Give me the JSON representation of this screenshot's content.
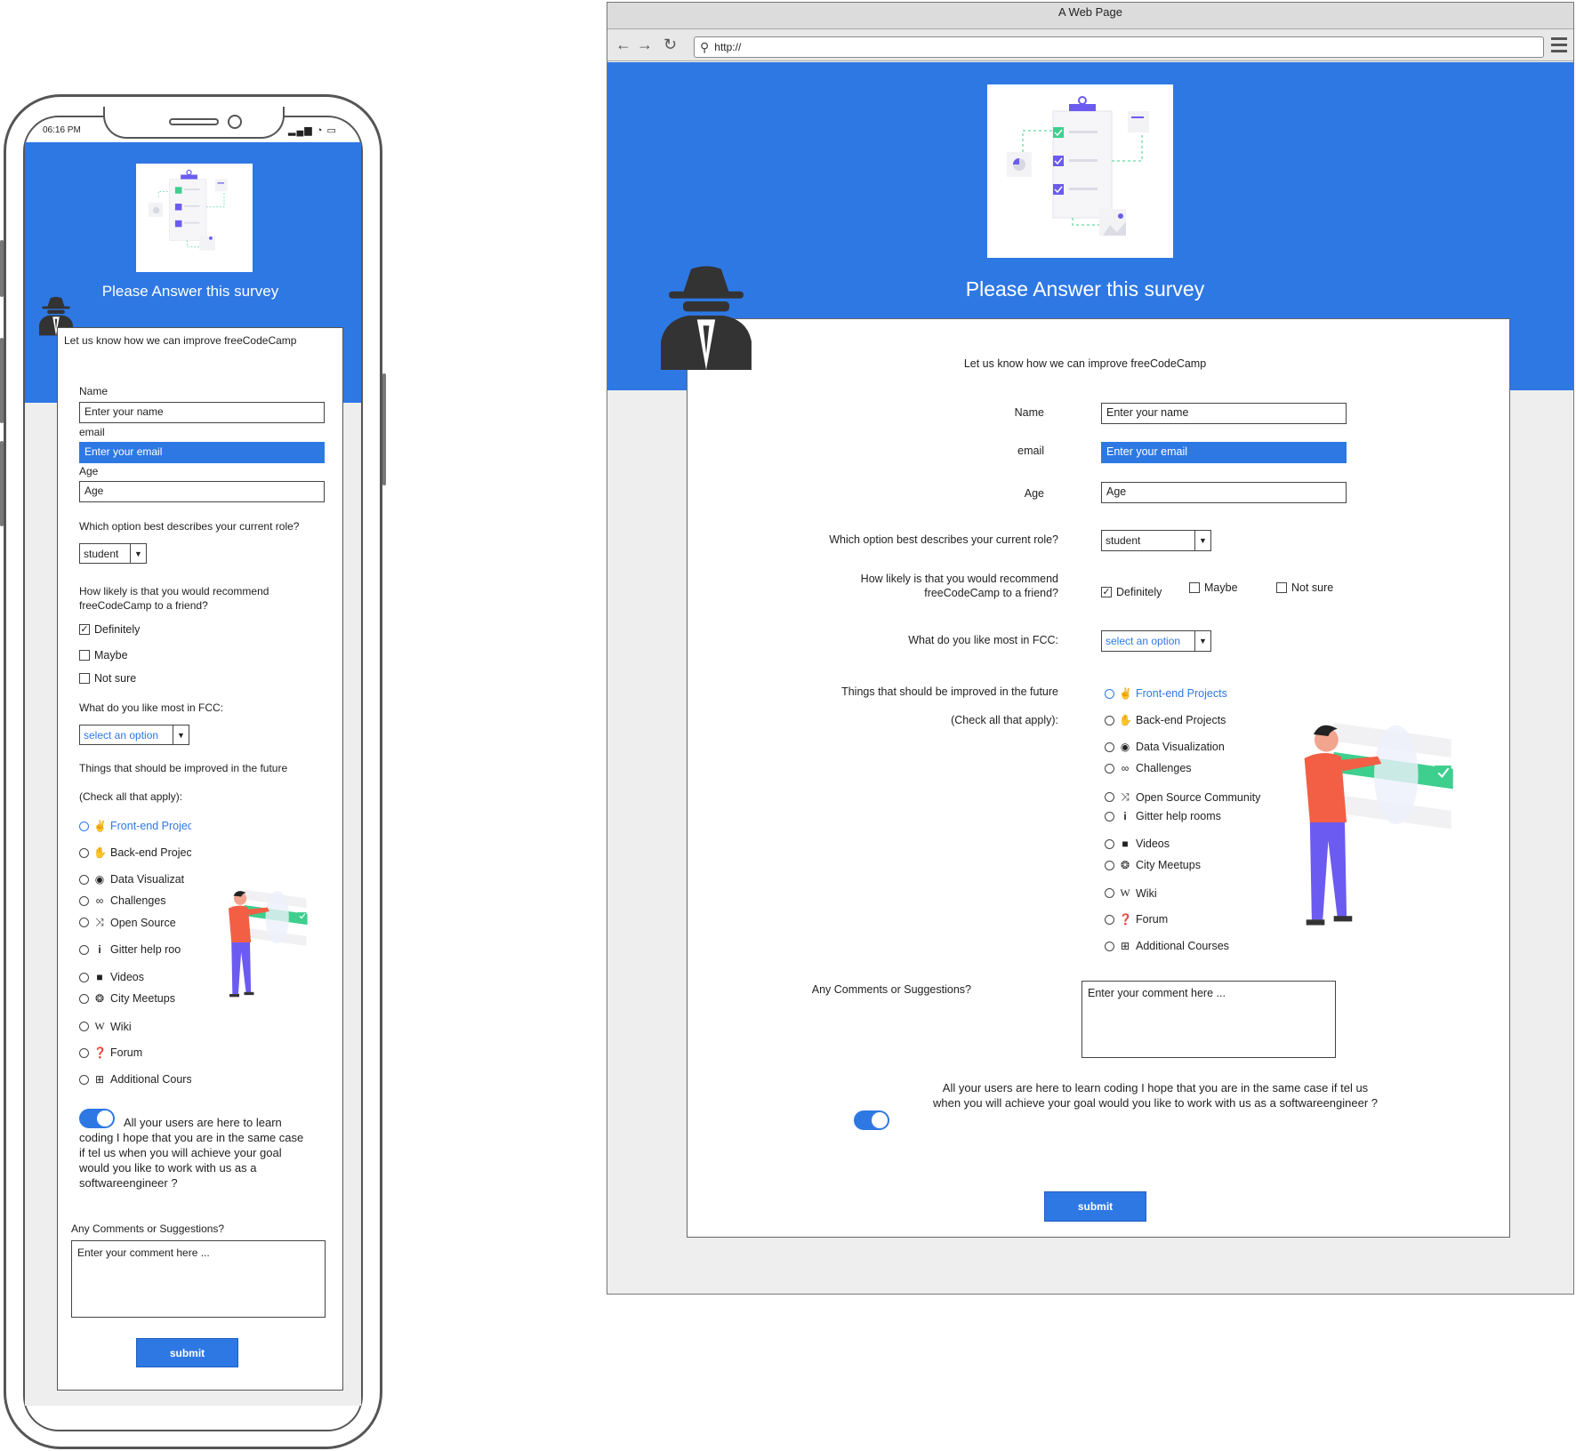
{
  "mobile": {
    "status_time": "06:16 PM",
    "status_icons": "▂▄▆ ◔ ▭",
    "title": "Please Answer this survey",
    "subtitle": "Let us know how we can improve freeCodeCamp",
    "name_label": "Name",
    "name_placeholder": "Enter your name",
    "email_label": "email",
    "email_placeholder": "Enter your email",
    "age_label": "Age",
    "age_placeholder": "Age",
    "role_question": "Which option best describes your current role?",
    "role_value": "student",
    "recommend_question_1": "How likely is that you would recommend",
    "recommend_question_2": "freeCodeCamp to a friend?",
    "recommend_options": [
      "Definitely",
      "Maybe",
      "Not sure"
    ],
    "like_question": "What do you like most in FCC:",
    "like_value": "select an option",
    "improve_question": "Things that should be improved in the future",
    "improve_hint": "(Check all that apply):",
    "improve_options": [
      "Front-end Projects",
      "Back-end Projects",
      "Data Visualizat",
      "Challenges",
      "Open Source",
      "Gitter help roo",
      "Videos",
      "City Meetups",
      "Wiki",
      "Forum",
      "Additional Courses"
    ],
    "toggle_text": "All your users are here to learn coding I hope that you are in the same case if tel us when you will achieve your goal would you like to work with us as a softwareengineer ?",
    "comments_label": "Any Comments or Suggestions?",
    "comments_placeholder": "Enter your comment here ...",
    "submit": "submit"
  },
  "browser": {
    "window_title": "A Web Page",
    "url": "http://",
    "title": "Please Answer this survey",
    "subtitle": "Let us know how we can improve freeCodeCamp",
    "name_label": "Name",
    "name_placeholder": "Enter your name",
    "email_label": "email",
    "email_placeholder": "Enter your email",
    "age_label": "Age",
    "age_placeholder": "Age",
    "role_question": "Which option best describes your current role?",
    "role_value": "student",
    "recommend_question_1": "How likely is that you would recommend",
    "recommend_question_2": "freeCodeCamp to a friend?",
    "recommend_options": [
      "Definitely",
      "Maybe",
      "Not sure"
    ],
    "like_question": "What do you like most in FCC:",
    "like_value": "select an option",
    "improve_question": "Things that should be improved in the future",
    "improve_hint": "(Check all that apply):",
    "improve_options": [
      "Front-end Projects",
      "Back-end Projects",
      "Data Visualization",
      "Challenges",
      "Open Source Community",
      "Gitter help rooms",
      "Videos",
      "City Meetups",
      "Wiki",
      "Forum",
      "Additional Courses"
    ],
    "comments_label": "Any Comments or Suggestions?",
    "comments_placeholder": "Enter your comment here ...",
    "toggle_text_1": "All your users are here to learn coding I hope that you are in the same case if tel us",
    "toggle_text_2": "when you will achieve your goal would you like to work with us as a softwareengineer ?",
    "submit": "submit"
  },
  "icons": {
    "nav_back": "←",
    "nav_forward": "→",
    "nav_reload": "↻",
    "search": "⚲",
    "dropdown_arrow": "▼",
    "checkmark": "✓",
    "option_icons": [
      "✌",
      "✋",
      "◉",
      "∞",
      "⤨",
      "i",
      "■",
      "❂",
      "W",
      "❓",
      "⊞"
    ]
  },
  "colors": {
    "primary": "#2e78e4",
    "background": "#eeeeee",
    "person_shirt": "#f25f45",
    "person_pants": "#6b5bf0",
    "accent_green": "#3ecf8e"
  }
}
